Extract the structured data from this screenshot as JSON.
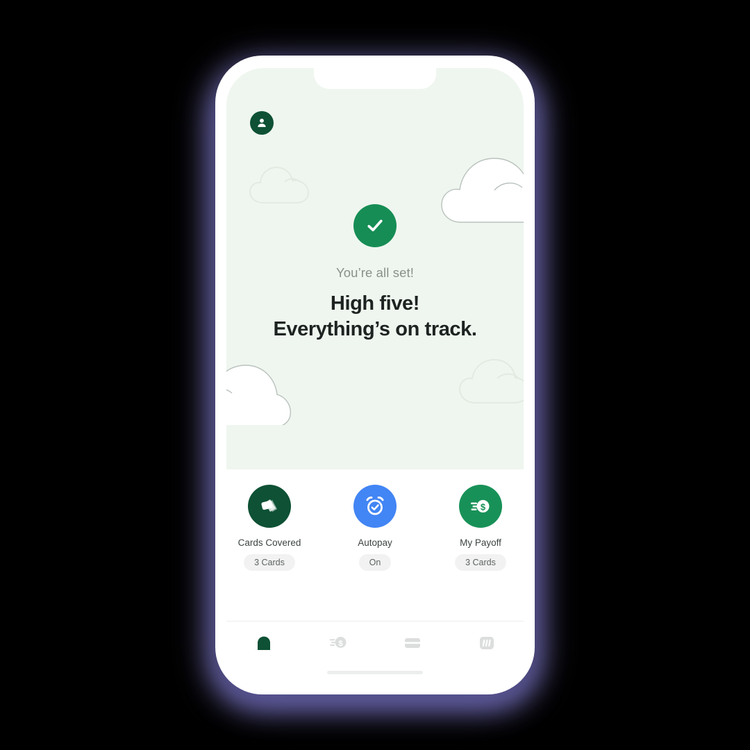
{
  "app": {
    "background_color": "#000000",
    "device_frame_color": "#ffffff",
    "shadow_color": "#8b86c9"
  },
  "header": {
    "avatar_icon": "person-avatar-icon",
    "avatar_color": "#0e5135"
  },
  "hero": {
    "background_color": "#eff6ef",
    "status_icon": "check-circle-icon",
    "status_icon_color": "#168d55",
    "eyebrow": "You’re all set!",
    "headline_line1": "High five!",
    "headline_line2": "Everything’s on track.",
    "headline_color": "#1d2321",
    "decorations": [
      {
        "name": "cloud-outline-top-left",
        "style": "outline"
      },
      {
        "name": "cloud-filled-top-right",
        "style": "filled"
      },
      {
        "name": "cloud-filled-bottom-left",
        "style": "filled"
      },
      {
        "name": "cloud-outline-bottom-right",
        "style": "outline"
      }
    ]
  },
  "actions": [
    {
      "label": "Cards Covered",
      "value": "3 Cards",
      "icon": "stacked-cards-icon",
      "icon_bg": "#0e5135"
    },
    {
      "label": "Autopay",
      "value": "On",
      "icon": "alarm-clock-check-icon",
      "icon_bg": "#4285f4"
    },
    {
      "label": "My Payoff",
      "value": "3 Cards",
      "icon": "fast-dollar-coin-icon",
      "icon_bg": "#189158"
    }
  ],
  "tabbar": {
    "active_index": 0,
    "active_color": "#0e5135",
    "inactive_color": "#dcdedd",
    "items": [
      {
        "name": "tab-home",
        "icon": "home-icon",
        "active": true
      },
      {
        "name": "tab-payoff",
        "icon": "fast-dollar-coin-icon",
        "active": false
      },
      {
        "name": "tab-cards",
        "icon": "credit-card-icon",
        "active": false
      },
      {
        "name": "tab-offers",
        "icon": "offers-bars-icon",
        "active": false
      }
    ],
    "home_indicator": "home-indicator-bar"
  }
}
